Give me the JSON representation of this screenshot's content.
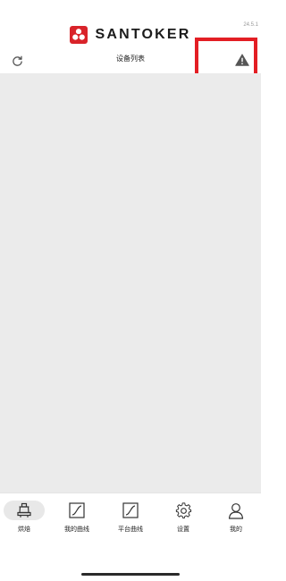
{
  "app": {
    "version": "24.5.1",
    "brand": "SANTOKER",
    "brand_color": "#d9232a"
  },
  "toolbar": {
    "title": "设备列表",
    "refresh_icon": "refresh-icon",
    "warning_icon": "warning-icon",
    "highlight_color": "#e31e24"
  },
  "tabs": [
    {
      "label": "烘焙",
      "icon": "roaster-icon",
      "active": true
    },
    {
      "label": "我的曲线",
      "icon": "curve-icon",
      "active": false
    },
    {
      "label": "平台曲线",
      "icon": "curve-icon",
      "active": false
    },
    {
      "label": "设置",
      "icon": "gear-icon",
      "active": false
    },
    {
      "label": "我的",
      "icon": "user-icon",
      "active": false
    }
  ]
}
